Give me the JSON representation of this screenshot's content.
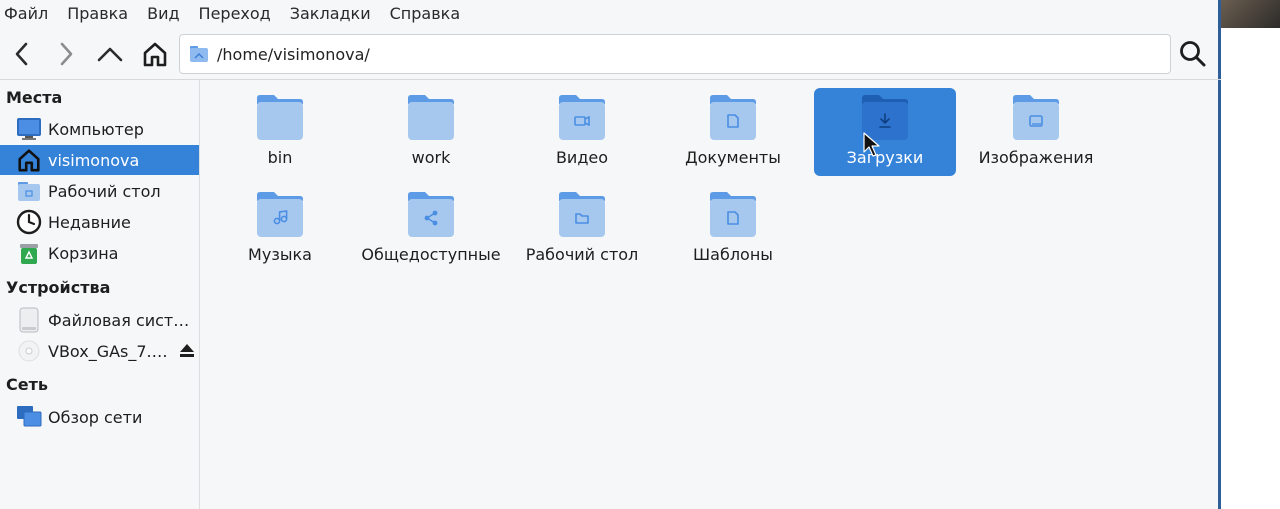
{
  "menu": [
    "Файл",
    "Правка",
    "Вид",
    "Переход",
    "Закладки",
    "Справка"
  ],
  "toolbar": {
    "back_icon": "chevron-left-icon",
    "forward_icon": "chevron-right-icon",
    "up_icon": "chevron-up-icon",
    "home_icon": "home-icon",
    "path": "/home/visimonova/",
    "search_icon": "search-icon"
  },
  "sidebar": {
    "places_title": "Места",
    "places": [
      {
        "label": "Компьютер",
        "icon": "monitor-icon"
      },
      {
        "label": "visimonova",
        "icon": "home-icon",
        "selected": true
      },
      {
        "label": "Рабочий стол",
        "icon": "desktop-folder-icon"
      },
      {
        "label": "Недавние",
        "icon": "clock-icon"
      },
      {
        "label": "Корзина",
        "icon": "trash-icon"
      }
    ],
    "devices_title": "Устройства",
    "devices": [
      {
        "label": "Файловая сист…",
        "icon": "drive-icon"
      },
      {
        "label": "VBox_GAs_7.…",
        "icon": "disc-icon",
        "eject": true
      }
    ],
    "network_title": "Сеть",
    "network": [
      {
        "label": "Обзор сети",
        "icon": "network-icon"
      }
    ]
  },
  "files": [
    {
      "name": "bin",
      "icon": "folder-icon"
    },
    {
      "name": "work",
      "icon": "folder-icon"
    },
    {
      "name": "Видео",
      "icon": "folder-video-icon"
    },
    {
      "name": "Документы",
      "icon": "folder-documents-icon"
    },
    {
      "name": "Загрузки",
      "icon": "folder-download-icon",
      "selected": true
    },
    {
      "name": "Изображения",
      "icon": "folder-pictures-icon"
    },
    {
      "name": "Музыка",
      "icon": "folder-music-icon"
    },
    {
      "name": "Общедоступные",
      "icon": "folder-share-icon"
    },
    {
      "name": "Рабочий стол",
      "icon": "folder-desktop-icon"
    },
    {
      "name": "Шаблоны",
      "icon": "folder-templates-icon"
    }
  ],
  "colors": {
    "accent": "#3583d9",
    "folder": "#a7c8ee",
    "folder_tab": "#5d9be6",
    "folder_symbol": "#4a8ee3"
  }
}
